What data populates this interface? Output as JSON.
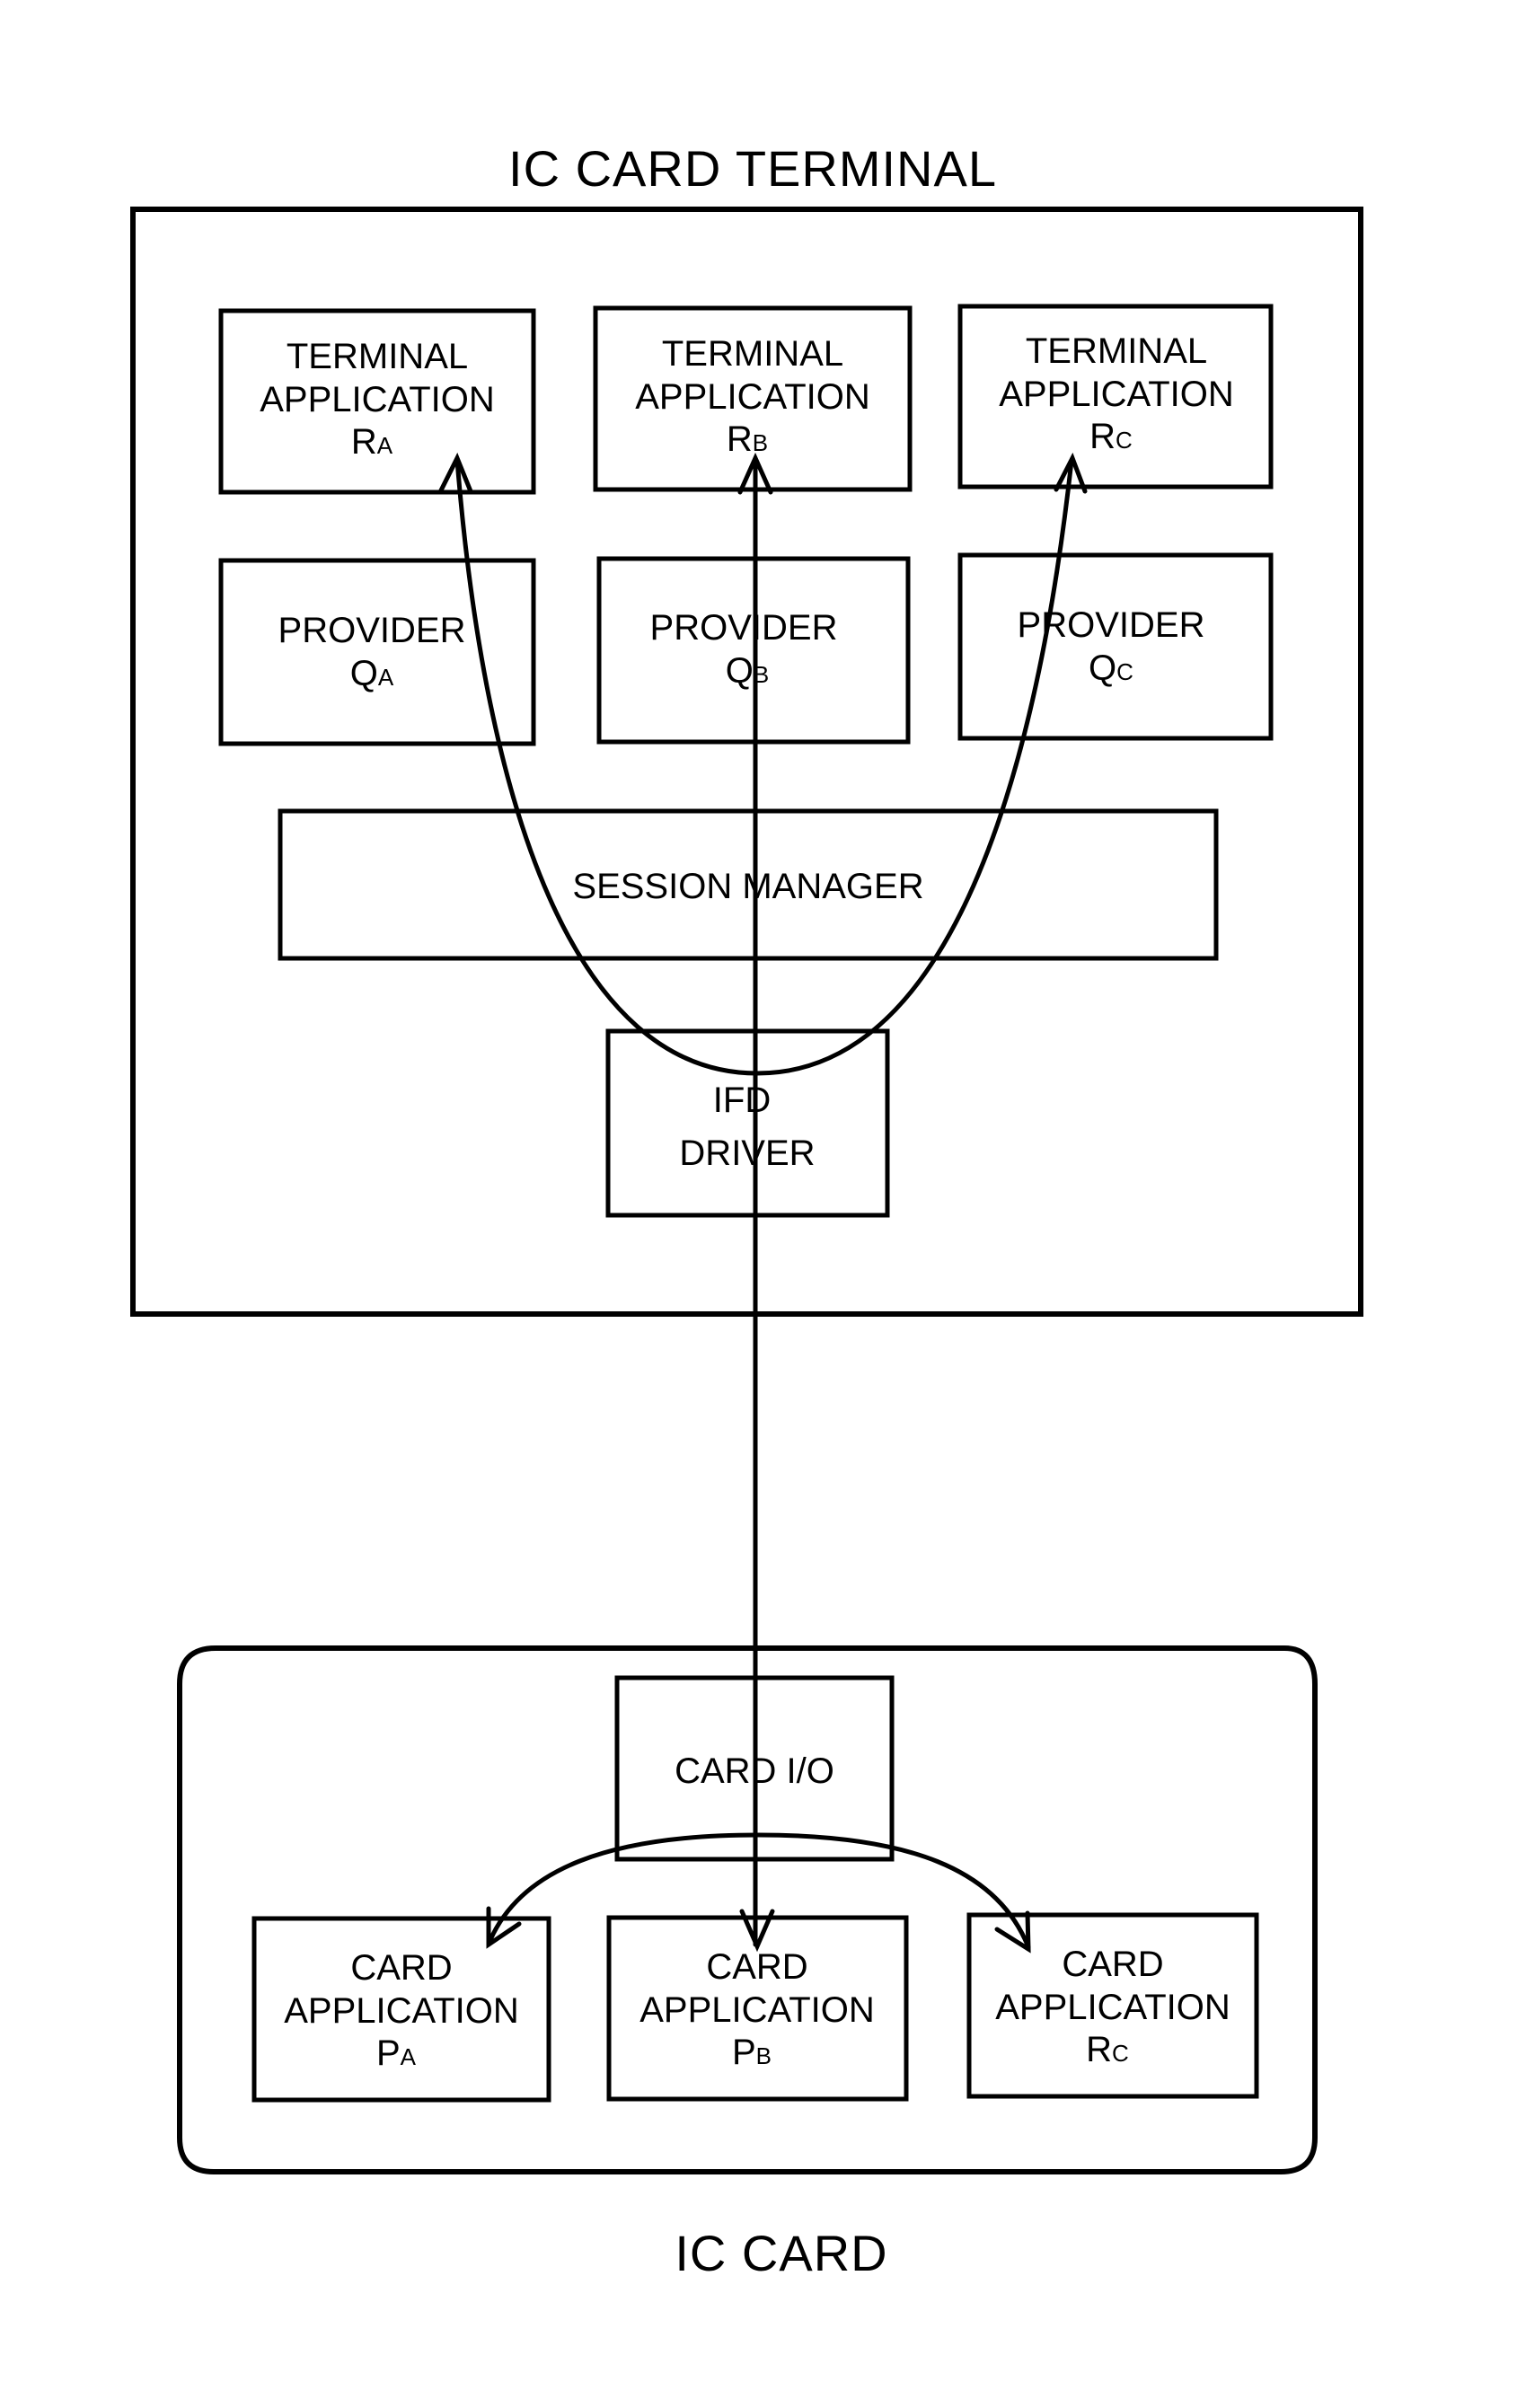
{
  "terminal": {
    "title": "IC CARD TERMINAL",
    "terminal_applications": [
      {
        "line1": "TERMINAL",
        "line2": "APPLICATION",
        "symbol": "R",
        "subscript": "A"
      },
      {
        "line1": "TERMINAL",
        "line2": "APPLICATION",
        "symbol": "R",
        "subscript": "B"
      },
      {
        "line1": "TERMINAL",
        "line2": "APPLICATION",
        "symbol": "R",
        "subscript": "C"
      }
    ],
    "providers": [
      {
        "line1": "PROVIDER",
        "symbol": "Q",
        "subscript": "A"
      },
      {
        "line1": "PROVIDER",
        "symbol": "Q",
        "subscript": "B"
      },
      {
        "line1": "PROVIDER",
        "symbol": "Q",
        "subscript": "C"
      }
    ],
    "session_manager": "SESSION MANAGER",
    "ifd_driver": {
      "line1": "IFD",
      "line2": "DRIVER"
    }
  },
  "card": {
    "title": "IC CARD",
    "card_io": "CARD I/O",
    "card_applications": [
      {
        "line1": "CARD",
        "line2": "APPLICATION",
        "symbol": "P",
        "subscript": "A"
      },
      {
        "line1": "CARD",
        "line2": "APPLICATION",
        "symbol": "P",
        "subscript": "B"
      },
      {
        "line1": "CARD",
        "line2": "APPLICATION",
        "symbol": "R",
        "subscript": "C"
      }
    ]
  },
  "connections": [
    {
      "from": "IFD DRIVER",
      "to": "TERMINAL APPLICATION RA",
      "type": "curved-arrow"
    },
    {
      "from": "IFD DRIVER",
      "to": "TERMINAL APPLICATION RC",
      "type": "curved-arrow"
    },
    {
      "from": "CARD APPLICATION PB",
      "to": "TERMINAL APPLICATION RB",
      "type": "bidirectional-arrow"
    },
    {
      "from": "CARD I/O",
      "to": "CARD APPLICATION PA",
      "type": "curved-arrow"
    },
    {
      "from": "CARD I/O",
      "to": "CARD APPLICATION RC",
      "type": "curved-arrow"
    }
  ]
}
